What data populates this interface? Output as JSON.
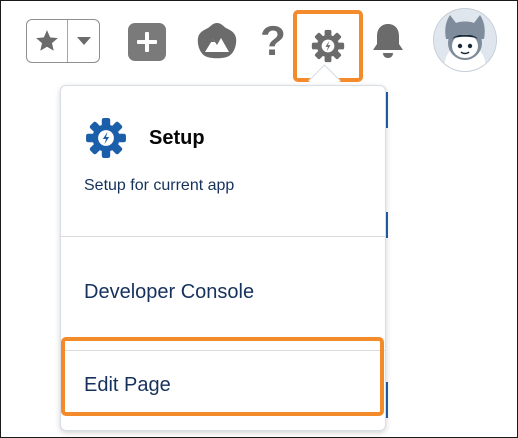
{
  "header": {
    "icons": [
      {
        "name": "favorites-star-icon"
      },
      {
        "name": "favorites-dropdown-icon"
      },
      {
        "name": "global-actions-plus-icon"
      },
      {
        "name": "trailhead-icon"
      },
      {
        "name": "help-icon"
      },
      {
        "name": "setup-gear-icon"
      },
      {
        "name": "notifications-bell-icon"
      },
      {
        "name": "user-avatar"
      }
    ],
    "help_glyph": "?",
    "highlight_color": "#f38b2b"
  },
  "setup_menu": {
    "setup_title": "Setup",
    "setup_subtitle": "Setup for current app",
    "items": [
      {
        "label": "Developer Console"
      },
      {
        "label": "Edit Page"
      }
    ]
  },
  "colors": {
    "gear_blue": "#1b5ea9",
    "icon_gray": "#6b6b6b",
    "text_navy": "#16325c"
  }
}
